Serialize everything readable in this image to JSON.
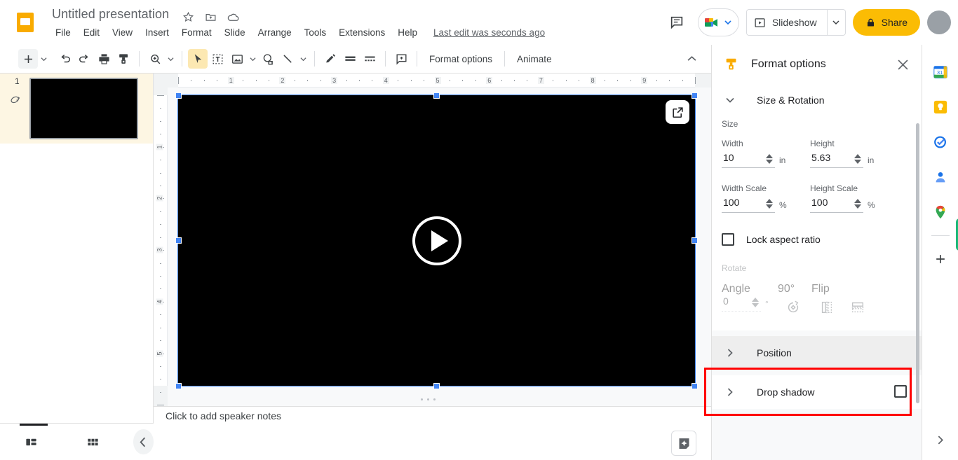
{
  "app": {
    "product": "Google Slides",
    "logo_icon": "slides-logo-icon"
  },
  "topbar": {
    "doc_title": "Untitled presentation",
    "title_icons": [
      {
        "name": "star-icon",
        "glyph": "☆"
      },
      {
        "name": "move-to-folder-icon",
        "glyph": "folder"
      },
      {
        "name": "cloud-saved-icon",
        "glyph": "cloud"
      }
    ],
    "menus": [
      "File",
      "Edit",
      "View",
      "Insert",
      "Format",
      "Slide",
      "Arrange",
      "Tools",
      "Extensions",
      "Help"
    ],
    "last_edit": "Last edit was seconds ago",
    "comment_history_label": "comment-history-icon",
    "meet_label": "meet-icon",
    "slideshow_label": "Slideshow",
    "share_label": "Share",
    "avatar_label": "account-avatar"
  },
  "toolbar": {
    "items": [
      {
        "name": "new-slide-button",
        "icon": "plus-icon",
        "caret": true,
        "state": "shaded"
      },
      {
        "name": "undo-button",
        "icon": "undo-icon"
      },
      {
        "name": "redo-button",
        "icon": "redo-icon"
      },
      {
        "name": "print-button",
        "icon": "print-icon"
      },
      {
        "name": "paint-format-button",
        "icon": "paint-format-icon"
      },
      {
        "name": "zoom-button",
        "icon": "zoom-icon",
        "caret": true
      },
      {
        "name": "select-tool-button",
        "icon": "cursor-icon",
        "state": "active"
      },
      {
        "name": "text-box-button",
        "icon": "text-box-icon"
      },
      {
        "name": "insert-image-button",
        "icon": "image-icon",
        "caret": true
      },
      {
        "name": "shape-button",
        "icon": "shape-icon"
      },
      {
        "name": "line-button",
        "icon": "line-icon",
        "caret": true
      },
      {
        "name": "pen-button",
        "icon": "pen-icon"
      },
      {
        "name": "background-lines-button",
        "icon": "lines-icon"
      },
      {
        "name": "transition-button",
        "icon": "transition-icon"
      },
      {
        "name": "comment-button",
        "icon": "add-comment-icon"
      }
    ],
    "format_options_label": "Format options",
    "animate_label": "Animate",
    "collapse_label": "collapse-toolbar-icon"
  },
  "filmstrip": {
    "slides": [
      {
        "number": "1",
        "selected": true,
        "layers_icon": "layers-icon"
      }
    ],
    "bottom": {
      "filmstrip_view": "filmstrip-view-icon",
      "grid_view": "grid-view-icon",
      "collapse": "collapse-filmstrip-icon"
    }
  },
  "canvas": {
    "ruler_h_labels": [
      "1",
      "2",
      "3",
      "4",
      "5",
      "6",
      "7",
      "8",
      "9"
    ],
    "ruler_v_labels": [
      "1",
      "2",
      "3",
      "4",
      "5"
    ],
    "video": {
      "name": "video-placeholder",
      "play_icon": "play-circle-icon",
      "open_external_icon": "open-in-new-icon"
    },
    "selection": "selection-handles"
  },
  "notes": {
    "placeholder": "Click to add speaker notes"
  },
  "explore": {
    "label": "explore-button"
  },
  "format_options": {
    "title": "Format options",
    "icon": "format-paint-icon",
    "close_label": "close-panel-icon",
    "size_rotation": {
      "section_label": "Size & Rotation",
      "expanded": true,
      "size_group_label": "Size",
      "width_label": "Width",
      "width_value": "10",
      "width_unit": "in",
      "height_label": "Height",
      "height_value": "5.63",
      "height_unit": "in",
      "width_scale_label": "Width Scale",
      "width_scale_value": "100",
      "width_scale_unit": "%",
      "height_scale_label": "Height Scale",
      "height_scale_value": "100",
      "height_scale_unit": "%",
      "lock_aspect_label": "Lock aspect ratio",
      "lock_aspect_checked": false,
      "rotate_group_label": "Rotate",
      "angle_label": "Angle",
      "angle_value": "0",
      "angle_unit": "°",
      "rotate90_label": "90°",
      "flip_label": "Flip",
      "rotate_disabled": true
    },
    "position": {
      "section_label": "Position",
      "expanded": false,
      "highlighted": true
    },
    "drop_shadow": {
      "section_label": "Drop shadow",
      "expanded": false,
      "checked": false
    }
  },
  "side_rail": {
    "items": [
      {
        "name": "google-calendar-icon",
        "label": "Calendar"
      },
      {
        "name": "google-keep-icon",
        "label": "Keep"
      },
      {
        "name": "google-tasks-icon",
        "label": "Tasks"
      },
      {
        "name": "google-contacts-icon",
        "label": "Contacts"
      },
      {
        "name": "google-maps-icon",
        "label": "Maps"
      }
    ],
    "add_label": "get-add-ons-icon",
    "expand_label": "expand-side-panel-icon"
  },
  "colors": {
    "brand_yellow": "#fbbc04",
    "accent_blue": "#4285f4",
    "annotation_red": "#ff0000",
    "selected_thumb_bg": "#fdf6e3"
  }
}
